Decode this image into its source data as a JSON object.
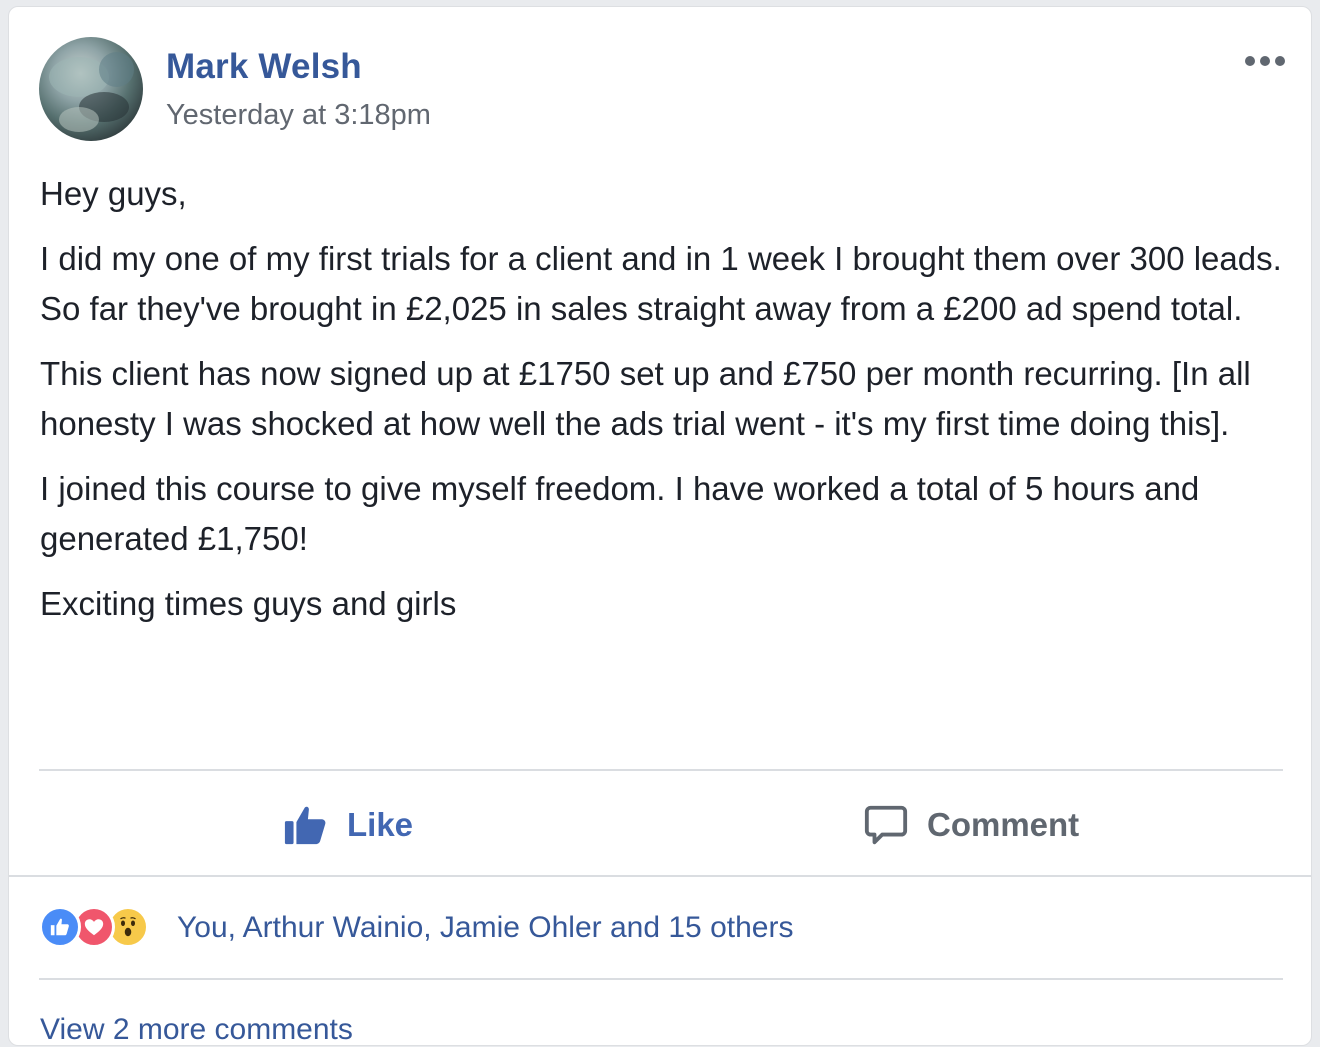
{
  "post": {
    "author": "Mark Welsh",
    "timestamp": "Yesterday at 3:18pm",
    "more_menu_icon": "ellipsis-icon",
    "paragraphs": [
      "Hey guys,",
      "I did my one of my first trials for a client and in 1 week I brought them over 300 leads. So far they've brought in £2,025 in sales straight away from a £200 ad spend total.",
      "This client has now signed up at £1750 set up and £750 per month recurring. [In all honesty I was shocked at how well the ads trial went - it's my first time doing this].",
      "I joined this course to give myself freedom. I have worked a total of 5 hours and generated £1,750!",
      "Exciting times guys and girls"
    ]
  },
  "actions": {
    "like_label": "Like",
    "like_icon": "thumbs-up-icon",
    "comment_label": "Comment",
    "comment_icon": "speech-bubble-icon"
  },
  "reactions": {
    "types": [
      "like-icon",
      "love-icon",
      "wow-icon"
    ],
    "summary": "You, Arthur Wainio, Jamie Ohler and 15 others"
  },
  "comments": {
    "view_more_label": "View 2 more comments"
  },
  "colors": {
    "link_blue": "#365899",
    "action_blue": "#4267b2",
    "secondary_text": "#616770",
    "body_text": "#1d2129",
    "divider": "#dadde1",
    "like_reaction": "#4a8cf7",
    "love_reaction": "#f0566c",
    "wow_reaction": "#f7c94a"
  }
}
